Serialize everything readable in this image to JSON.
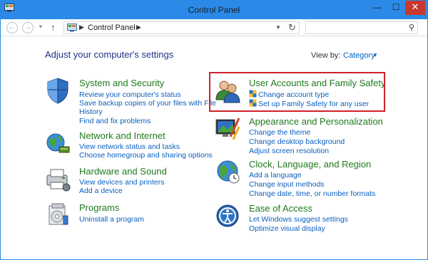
{
  "window": {
    "title": "Control Panel"
  },
  "titlebar": {
    "min": "—",
    "max": "☐",
    "close": "✕"
  },
  "nav": {
    "back": "←",
    "forward": "→",
    "up": "↑",
    "breadcrumb": "Control Panel",
    "search_placeholder": ""
  },
  "content": {
    "heading": "Adjust your computer's settings",
    "view_by_label": "View by:",
    "view_by_value": "Category"
  },
  "categories": [
    {
      "title": "System and Security",
      "links": [
        "Review your computer's status",
        "Save backup copies of your files with File",
        "History",
        "Find and fix problems"
      ]
    },
    {
      "title": "Network and Internet",
      "links": [
        "View network status and tasks",
        "Choose homegroup and sharing options"
      ]
    },
    {
      "title": "Hardware and Sound",
      "links": [
        "View devices and printers",
        "Add a device"
      ]
    },
    {
      "title": "Programs",
      "links": [
        "Uninstall a program"
      ]
    },
    {
      "title": "User Accounts and Family Safety",
      "links": [
        "Change account type",
        "Set up Family Safety for any user"
      ]
    },
    {
      "title": "Appearance and Personalization",
      "links": [
        "Change the theme",
        "Change desktop background",
        "Adjust screen resolution"
      ]
    },
    {
      "title": "Clock, Language, and Region",
      "links": [
        "Add a language",
        "Change input methods",
        "Change date, time, or number formats"
      ]
    },
    {
      "title": "Ease of Access",
      "links": [
        "Let Windows suggest settings",
        "Optimize visual display"
      ]
    }
  ],
  "colors": {
    "accent": "#2b8ae8",
    "link": "#0b5fbf",
    "category_title": "#1f7a1f",
    "highlight": "#d0202a"
  },
  "icons": [
    "control-panel-icon",
    "shield-icon",
    "globe-network-icon",
    "printer-icon",
    "programs-icon",
    "users-icon",
    "monitor-paint-icon",
    "globe-clock-icon",
    "ease-of-access-icon",
    "uac-shield-icon",
    "search-icon",
    "refresh-icon"
  ]
}
